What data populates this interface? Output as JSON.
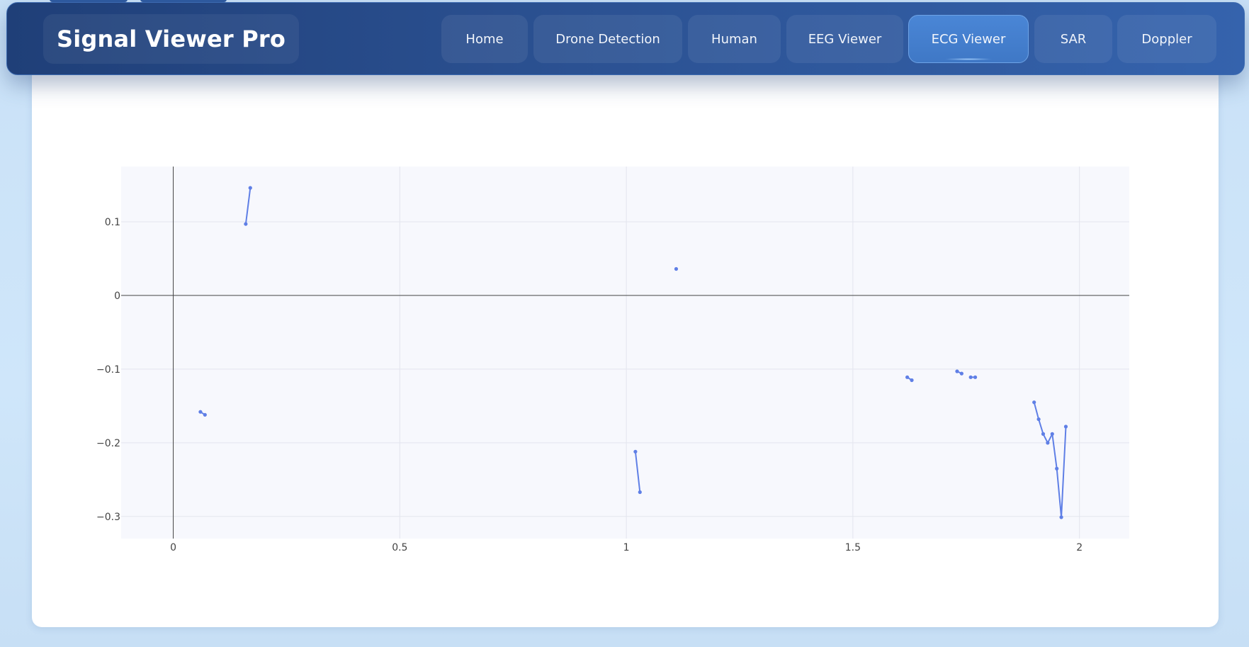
{
  "header": {
    "brand": "Signal Viewer Pro",
    "nav": [
      {
        "label": "Home",
        "active": false
      },
      {
        "label": "Drone Detection",
        "active": false
      },
      {
        "label": "Human",
        "active": false
      },
      {
        "label": "EEG Viewer",
        "active": false
      },
      {
        "label": "ECG Viewer",
        "active": true
      },
      {
        "label": "SAR",
        "active": false
      },
      {
        "label": "Doppler",
        "active": false
      }
    ]
  },
  "colors": {
    "nav_bg": "#2a4f8f",
    "accent": "#4a86d6",
    "trace": "#5f7fe6",
    "plot_bg": "#f7f8fd"
  },
  "chart_data": {
    "type": "line",
    "xlim": [
      -0.115,
      2.11
    ],
    "ylim": [
      -0.33,
      0.175
    ],
    "x_ticks": [
      0,
      0.5,
      1,
      1.5,
      2
    ],
    "x_tick_labels": [
      "0",
      "0.5",
      "1",
      "1.5",
      "2"
    ],
    "y_ticks": [
      -0.3,
      -0.2,
      -0.1,
      0,
      0.1
    ],
    "y_tick_labels": [
      "−0.3",
      "−0.2",
      "−0.1",
      "0",
      "0.1"
    ],
    "grid": true,
    "segments": [
      [
        [
          0.06,
          -0.158
        ],
        [
          0.07,
          -0.162
        ]
      ],
      [
        [
          0.16,
          0.097
        ],
        [
          0.17,
          0.146
        ]
      ],
      [
        [
          1.02,
          -0.212
        ],
        [
          1.03,
          -0.267
        ]
      ],
      [
        [
          1.11,
          0.036
        ]
      ],
      [
        [
          1.62,
          -0.111
        ],
        [
          1.63,
          -0.115
        ]
      ],
      [
        [
          1.73,
          -0.103
        ],
        [
          1.74,
          -0.106
        ]
      ],
      [
        [
          1.76,
          -0.111
        ],
        [
          1.77,
          -0.111
        ]
      ],
      [
        [
          1.9,
          -0.145
        ],
        [
          1.91,
          -0.168
        ],
        [
          1.92,
          -0.188
        ],
        [
          1.93,
          -0.2
        ],
        [
          1.94,
          -0.188
        ],
        [
          1.95,
          -0.235
        ],
        [
          1.96,
          -0.301
        ],
        [
          1.97,
          -0.178
        ]
      ]
    ]
  }
}
